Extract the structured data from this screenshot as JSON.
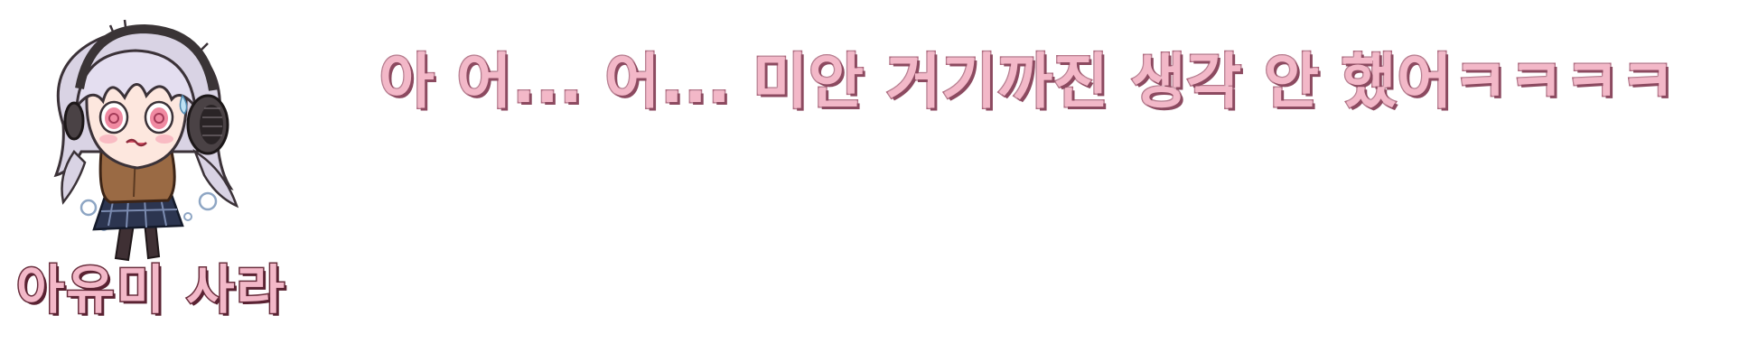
{
  "dialogue": {
    "speaker": "아유미 사라",
    "line": "아 어... 어... 미안 거기까진 생각 안 했어ㅋㅋㅋㅋ"
  },
  "portrait": {
    "icon": "chibi-girl-with-headphones-icon"
  },
  "colors": {
    "text_fill": "#f3b8c8",
    "dialogue_outline": "#a75a72",
    "name_outline": "#6a2f3e",
    "hair": "#d9d3e4",
    "headphones": "#3a3436",
    "jacket": "#9a6a44",
    "skirt": "#2c3550"
  }
}
